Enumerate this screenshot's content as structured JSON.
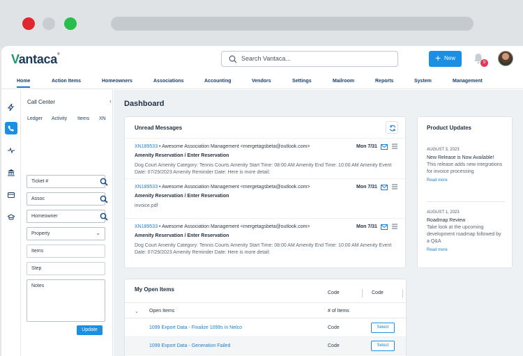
{
  "app": {
    "logo_prefix": "V",
    "logo_rest": "antaca",
    "logo_mark": "®"
  },
  "search": {
    "placeholder": "Search Vantaca..."
  },
  "header": {
    "new_label": "New",
    "notification_count": "9"
  },
  "nav": [
    "Home",
    "Action Items",
    "Homeowners",
    "Associations",
    "Accounting",
    "Vendors",
    "Settings",
    "Mailroom",
    "Reports",
    "System",
    "Management"
  ],
  "rail_icons": [
    "lightning-icon",
    "phone-icon",
    "pulse-icon",
    "bank-icon",
    "card-icon",
    "graduation-icon"
  ],
  "call_center": {
    "title": "Call Center",
    "collapse": "‹",
    "tabs": [
      "Ledger",
      "Activity",
      "Items",
      "XN"
    ],
    "ticket_ph": "Ticket #",
    "assoc_ph": "Assoc",
    "homeowner_ph": "Homeowner",
    "property_ph": "Property",
    "items_ph": "Items",
    "step_ph": "Step",
    "notes_ph": "Notes",
    "update_label": "Update"
  },
  "dashboard": {
    "title": "Dashboard"
  },
  "unread": {
    "title": "Unread Messages",
    "messages": [
      {
        "id": "XN189533",
        "sep": "•",
        "from": "Awesome Association Management",
        "email": "<mergetagsbeta@outlook.com>",
        "date": "Mon 7/31",
        "subject": "Amenity Reservation / Enter Reservation",
        "body": "Dog Court Amenity Category: Tennis Courts Amenity Start Time: 08:00 AM Amenity End Time: 10:00 AM Amenity Event Date: 07/29/2023 Amenity Reminder Date: Here is more detail:"
      },
      {
        "id": "XN189533",
        "sep": "•",
        "from": "Awesome Association Management",
        "email": "<mergetagsbeta@outlook.com>",
        "date": "Mon 7/31",
        "subject": "Amenity Reservation / Enter Reservation",
        "body": "invoice.pdf"
      },
      {
        "id": "XN189533",
        "sep": "•",
        "from": "Awesome Association Management",
        "email": "<mergetagsbeta@outlook.com>",
        "date": "Mon 7/31",
        "subject": "Amenity Reservation / Enter Reservation",
        "body": "Dog Court Amenity Category: Tennis Courts Amenity Start Time: 08:00 AM Amenity End Time: 10:00 AM Amenity Event Date: 07/29/2023 Amenity Reminder Date: Here is more detail:"
      }
    ]
  },
  "product_updates": {
    "title": "Product Updates",
    "items": [
      {
        "date": "AUGUST 3, 2023",
        "title": "New Release is Now Available!",
        "desc": "This release adds new integrations for invoice processing",
        "link": "Read more"
      },
      {
        "date": "AUGUST 1, 2023",
        "title": "Roadmap Review",
        "desc": "Take look at the upcoming development roadmap followed by a Q&A",
        "link": "Read more"
      }
    ]
  },
  "open_items": {
    "title": "My Open Items",
    "hdr_code1": "Code",
    "hdr_code2": "Code",
    "col_name": "Open Items",
    "col_count": "# of Items",
    "rows": [
      {
        "name": "1099 Export Data - Finalize 1099s in Nelco",
        "code": "Code",
        "action": "Select"
      },
      {
        "name": "1099 Export Data - Generation Failed",
        "code": "Code",
        "action": "Select"
      }
    ]
  }
}
